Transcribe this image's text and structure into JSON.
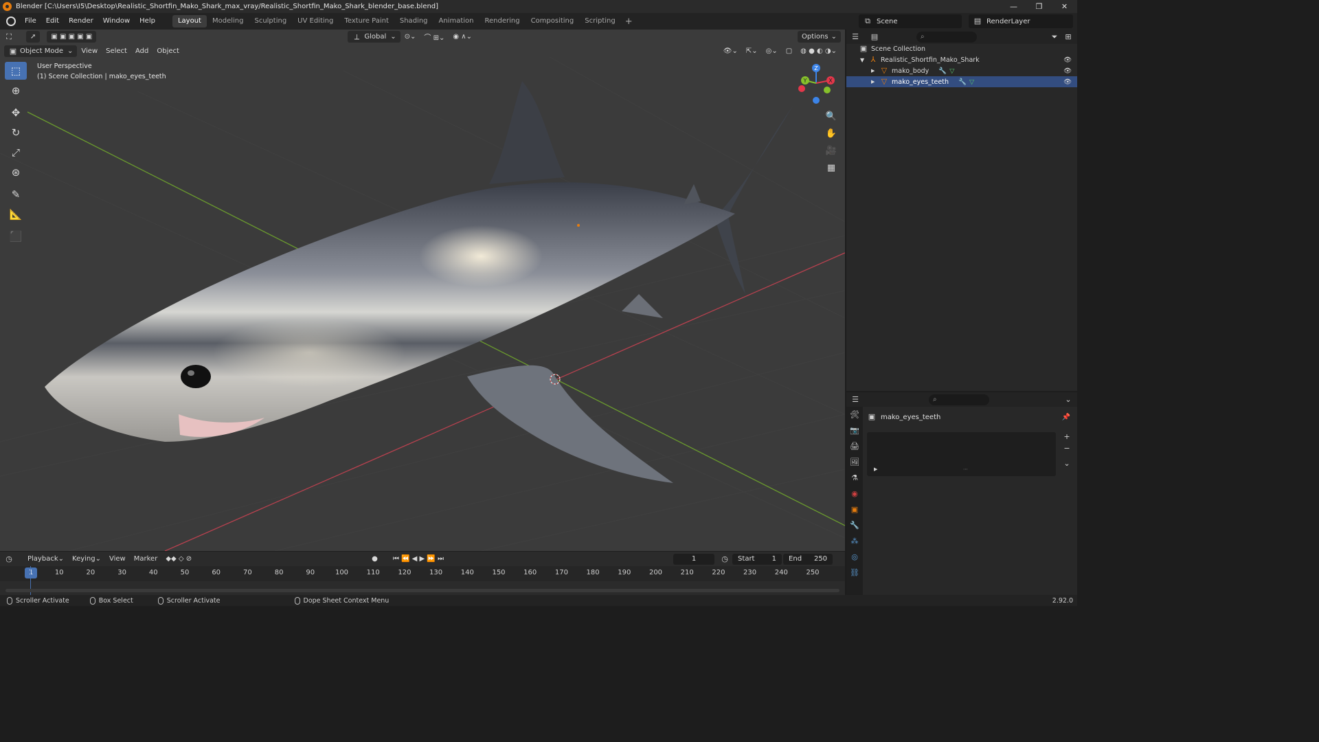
{
  "window": {
    "title": "Blender [C:\\Users\\I5\\Desktop\\Realistic_Shortfin_Mako_Shark_max_vray/Realistic_Shortfin_Mako_Shark_blender_base.blend]",
    "minimize": "—",
    "maximize": "❐",
    "close": "✕"
  },
  "menu": [
    "File",
    "Edit",
    "Render",
    "Window",
    "Help"
  ],
  "workspaces": [
    "Layout",
    "Modeling",
    "Sculpting",
    "UV Editing",
    "Texture Paint",
    "Shading",
    "Animation",
    "Rendering",
    "Compositing",
    "Scripting"
  ],
  "active_workspace": "Layout",
  "scene": {
    "name": "Scene",
    "view_layer": "RenderLayer"
  },
  "viewport": {
    "transform_orientation": "Global",
    "options_label": "Options",
    "mode": "Object Mode",
    "menus": [
      "View",
      "Select",
      "Add",
      "Object"
    ],
    "info_line1": "User Perspective",
    "info_line2": "(1) Scene Collection | mako_eyes_teeth",
    "gizmo_axes": {
      "z": "Z",
      "y": "Y",
      "x": "X"
    }
  },
  "outliner": {
    "root": "Scene Collection",
    "collection": "Realistic_Shortfin_Mako_Shark",
    "objects": [
      "mako_body",
      "mako_eyes_teeth"
    ]
  },
  "properties": {
    "object_name": "mako_eyes_teeth"
  },
  "timeline": {
    "menus": [
      "Playback",
      "Keying",
      "View",
      "Marker"
    ],
    "current_frame": "1",
    "start_label": "Start",
    "start": "1",
    "end_label": "End",
    "end": "250",
    "ticks": [
      "10",
      "20",
      "30",
      "40",
      "50",
      "60",
      "70",
      "80",
      "90",
      "100",
      "110",
      "120",
      "130",
      "140",
      "150",
      "160",
      "170",
      "180",
      "190",
      "200",
      "210",
      "220",
      "230",
      "240",
      "250"
    ]
  },
  "status": {
    "items": [
      "Scroller Activate",
      "Box Select",
      "Scroller Activate",
      "Dope Sheet Context Menu"
    ],
    "version": "2.92.0"
  },
  "colors": {
    "accent": "#4772b3",
    "axis_x": "#e3374a",
    "axis_y": "#86c12b",
    "axis_z": "#3c84e8",
    "object_orange": "#e87d0d"
  }
}
